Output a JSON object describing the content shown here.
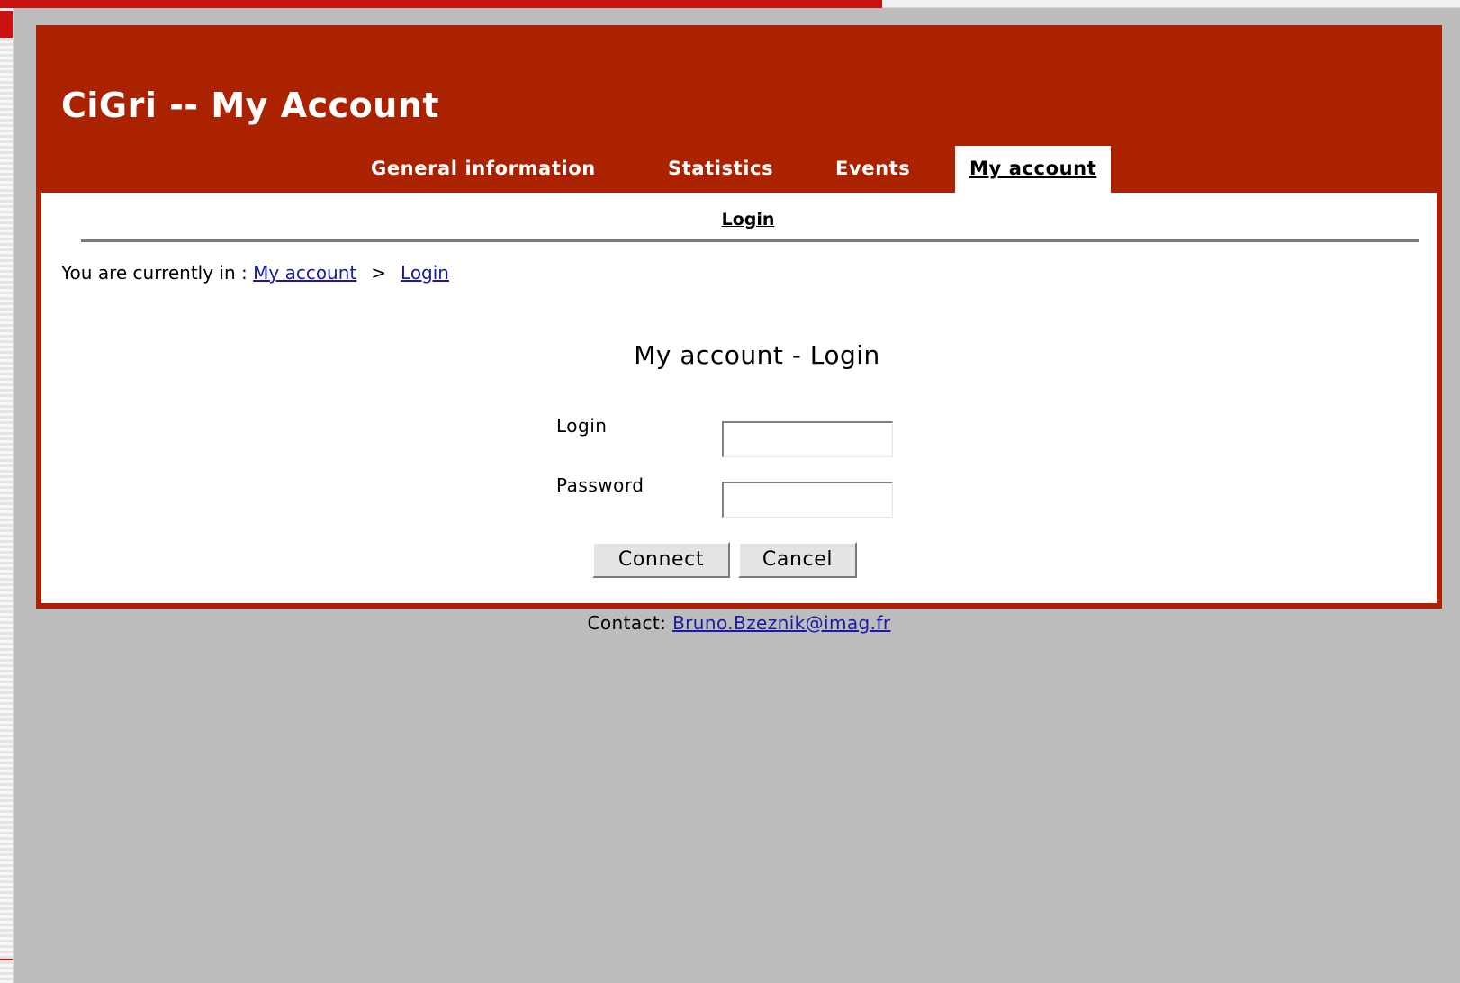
{
  "header": {
    "title": "CiGri -- My Account"
  },
  "tabs": [
    {
      "label": "General information",
      "active": false
    },
    {
      "label": "Statistics",
      "active": false
    },
    {
      "label": "Events",
      "active": false
    },
    {
      "label": "My account",
      "active": true
    }
  ],
  "subnav": {
    "items": [
      {
        "label": "Login"
      }
    ]
  },
  "breadcrumb": {
    "prefix": "You are currently in :",
    "items": [
      {
        "label": "My account"
      },
      {
        "label": "Login"
      }
    ],
    "separator": ">"
  },
  "form": {
    "title": "My account - Login",
    "login_label": "Login",
    "login_value": "",
    "password_label": "Password",
    "password_value": "",
    "connect_label": "Connect",
    "cancel_label": "Cancel"
  },
  "footer": {
    "contact_prefix": "Contact:",
    "contact_email": "Bruno.Bzeznik@imag.fr"
  },
  "colors": {
    "header_background": "#ab2200",
    "page_background": "#bcbcbc",
    "link": "#1a1aa6"
  }
}
